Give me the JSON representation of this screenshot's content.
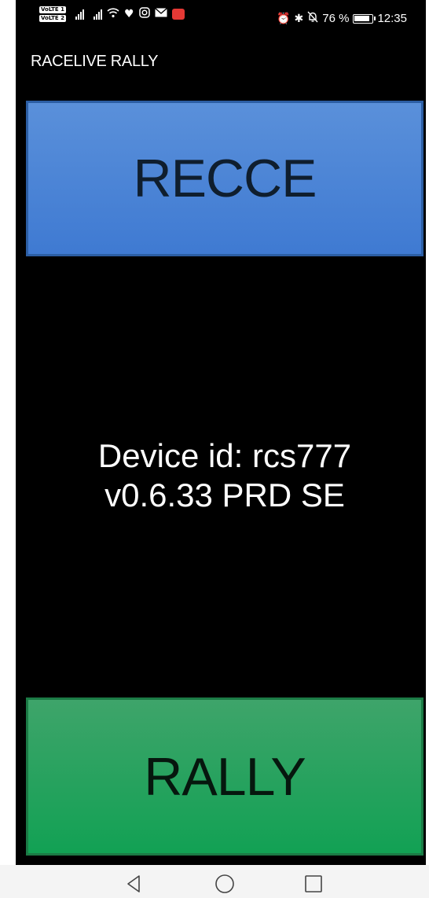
{
  "status_bar": {
    "volte_1": "VoLTE 1",
    "volte_2": "VoLTE 2",
    "icons_left": [
      "signal-icon",
      "signal-icon",
      "wifi-icon",
      "health-heart-icon",
      "instagram-icon",
      "mail-icon",
      "sms-app-icon"
    ],
    "icons_right": [
      "alarm-icon",
      "bluetooth-icon",
      "bell-off-icon"
    ],
    "battery_percent": "76 %",
    "battery_level": 0.76,
    "time": "12:35"
  },
  "app": {
    "title": "RACELIVE RALLY"
  },
  "buttons": {
    "recce_label": "RECCE",
    "rally_label": "RALLY"
  },
  "device": {
    "id_line": "Device id: rcs777",
    "version_line": "v0.6.33 PRD SE"
  },
  "nav_bar": {
    "icons": [
      "back-icon",
      "home-icon",
      "recent-apps-icon"
    ]
  },
  "colors": {
    "recce": "#4a86d6",
    "rally": "#17a45a",
    "background": "#000000"
  }
}
